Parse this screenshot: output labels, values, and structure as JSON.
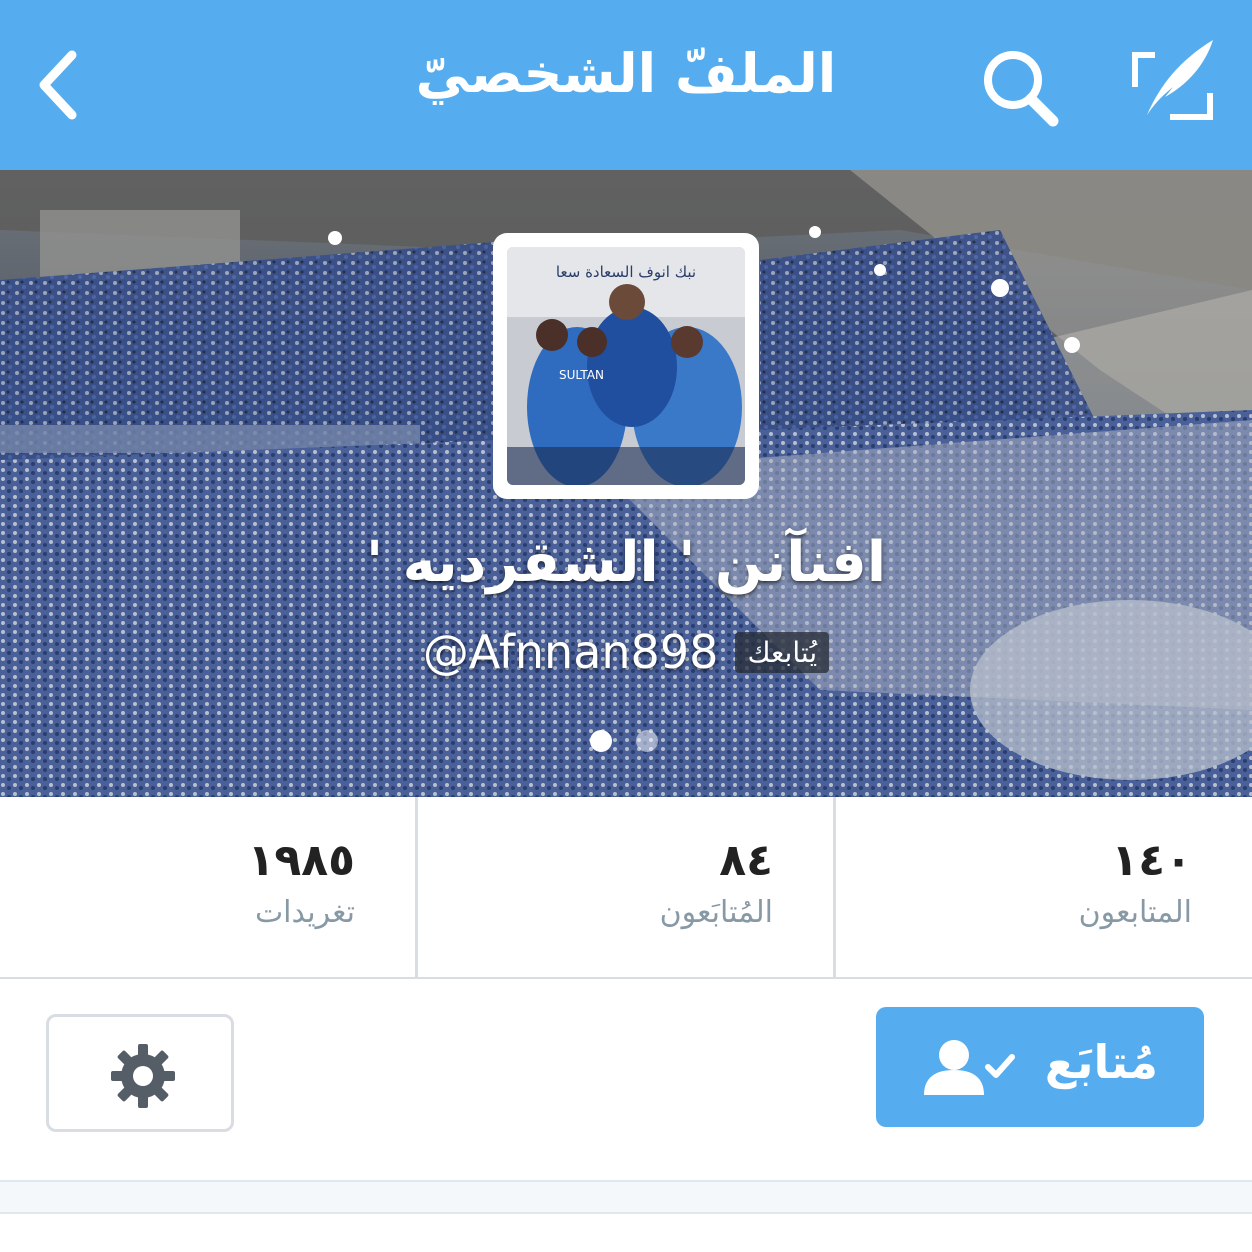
{
  "nav": {
    "title": "الملفّ الشخصيّ",
    "back_icon": "chevron-left-icon",
    "search_icon": "search-icon",
    "compose_icon": "compose-tweet-icon"
  },
  "profile": {
    "display_name": "افنآنن ' الشقرديه '",
    "follows_you": "يُتابعك",
    "handle": "@Afnnan898",
    "avatar_caption": "نبك انوف السعادة سعا",
    "jersey_text": "SULTAN"
  },
  "stats": [
    {
      "value": "١٤٠",
      "label": "المتابعون"
    },
    {
      "value": "٨٤",
      "label": "المُتابَعون"
    },
    {
      "value": "١٩٨٥",
      "label": "تغريدات"
    }
  ],
  "actions": {
    "follow_label": "مُتابَع",
    "follow_icon": "user-check-icon",
    "settings_icon": "gear-icon"
  },
  "pager": {
    "pages": 2,
    "active": 1
  },
  "colors": {
    "brand": "#55acee",
    "border": "#d7dde2",
    "muted": "#8899a6"
  }
}
